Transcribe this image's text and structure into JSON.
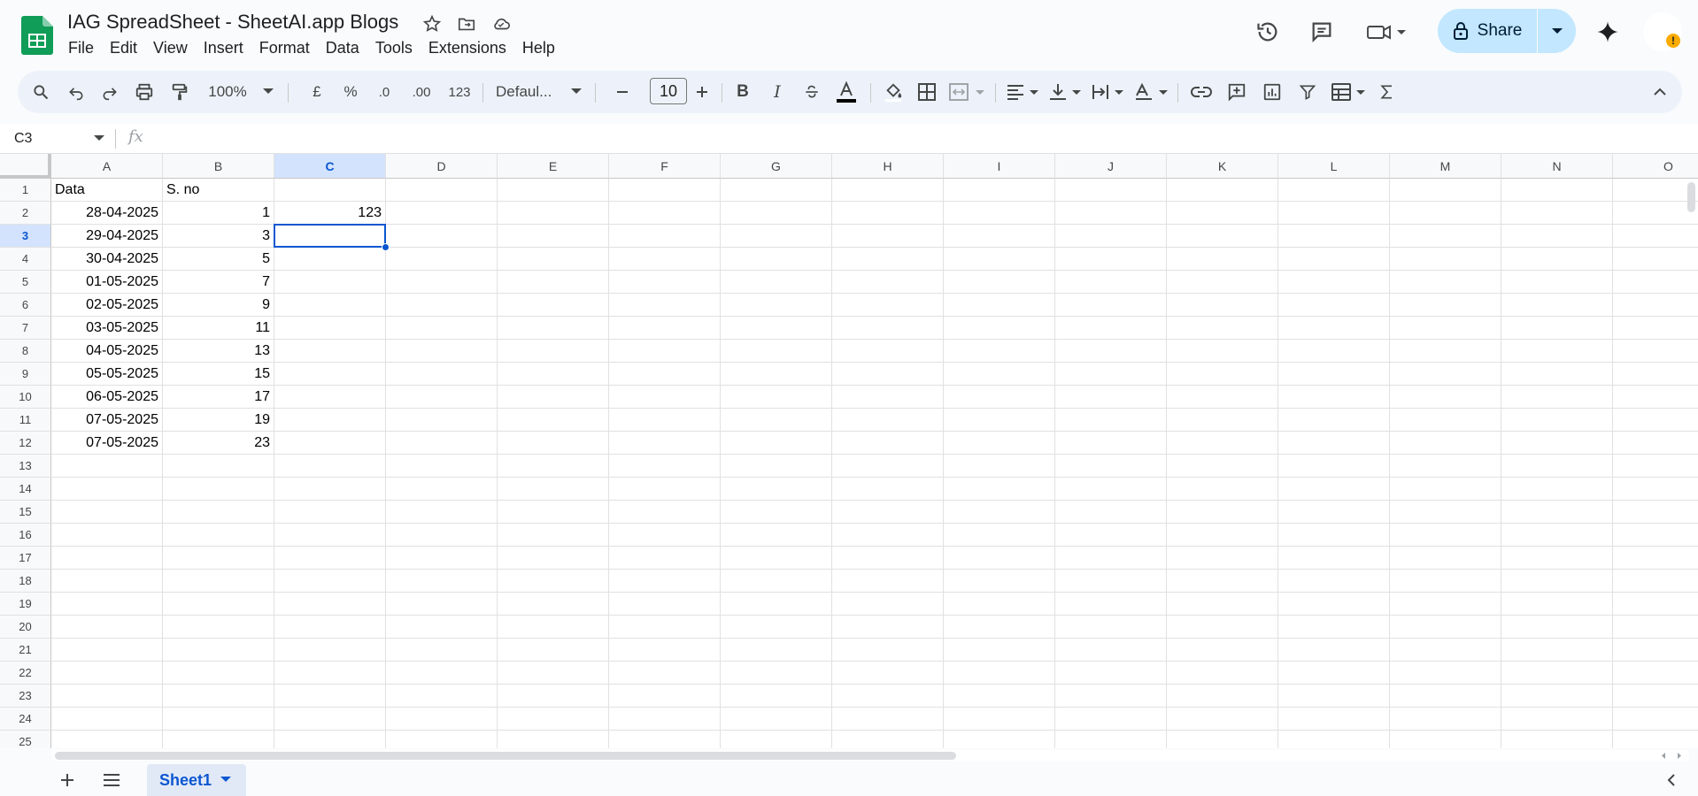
{
  "document": {
    "title": "IAG SpreadSheet - SheetAI.app Blogs"
  },
  "menu": [
    "File",
    "Edit",
    "View",
    "Insert",
    "Format",
    "Data",
    "Tools",
    "Extensions",
    "Help"
  ],
  "header_actions": {
    "share_label": "Share",
    "icons": [
      "version-history-icon",
      "comments-icon",
      "meet-icon",
      "gemini-icon",
      "account-avatar-icon"
    ]
  },
  "toolbar": {
    "zoom": "100%",
    "currency": "£",
    "percent": "%",
    "decrease_decimal": ".0",
    "increase_decimal": ".00",
    "more_formats": "123",
    "font_family": "Defaul...",
    "font_size": "10"
  },
  "formula_bar": {
    "name_box": "C3",
    "fx": "fx",
    "formula": ""
  },
  "grid": {
    "columns": [
      "A",
      "B",
      "C",
      "D",
      "E",
      "F",
      "G",
      "H",
      "I",
      "J",
      "K",
      "L",
      "M",
      "N",
      "O"
    ],
    "selected_column": "C",
    "selected_row": 3,
    "rows": [
      {
        "n": "1",
        "A": "Data",
        "B": "S. no",
        "C": ""
      },
      {
        "n": "2",
        "A": "28-04-2025",
        "B": "1",
        "C": "123"
      },
      {
        "n": "3",
        "A": "29-04-2025",
        "B": "3",
        "C": ""
      },
      {
        "n": "4",
        "A": "30-04-2025",
        "B": "5",
        "C": ""
      },
      {
        "n": "5",
        "A": "01-05-2025",
        "B": "7",
        "C": ""
      },
      {
        "n": "6",
        "A": "02-05-2025",
        "B": "9",
        "C": ""
      },
      {
        "n": "7",
        "A": "03-05-2025",
        "B": "11",
        "C": ""
      },
      {
        "n": "8",
        "A": "04-05-2025",
        "B": "13",
        "C": ""
      },
      {
        "n": "9",
        "A": "05-05-2025",
        "B": "15",
        "C": ""
      },
      {
        "n": "10",
        "A": "06-05-2025",
        "B": "17",
        "C": ""
      },
      {
        "n": "11",
        "A": "07-05-2025",
        "B": "19",
        "C": ""
      },
      {
        "n": "12",
        "A": "07-05-2025",
        "B": "23",
        "C": ""
      },
      {
        "n": "13"
      },
      {
        "n": "14"
      },
      {
        "n": "15"
      },
      {
        "n": "16"
      },
      {
        "n": "17"
      },
      {
        "n": "18"
      },
      {
        "n": "19"
      },
      {
        "n": "20"
      },
      {
        "n": "21"
      },
      {
        "n": "22"
      },
      {
        "n": "23"
      },
      {
        "n": "24"
      },
      {
        "n": "25"
      }
    ]
  },
  "sheets": {
    "active": "Sheet1"
  },
  "colors": {
    "accent": "#0b57d0",
    "share_bg": "#c2e7ff",
    "sheets_green": "#0f9d58",
    "warning": "#f9ab00"
  }
}
